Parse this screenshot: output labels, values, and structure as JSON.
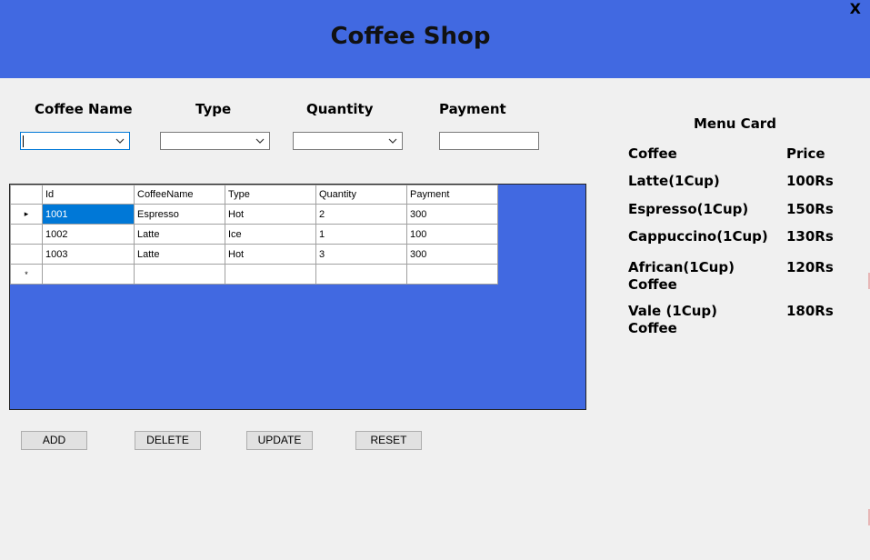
{
  "app": {
    "title": "Coffee Shop",
    "close_label": "X"
  },
  "form": {
    "coffee_name_label": "Coffee Name",
    "type_label": "Type",
    "quantity_label": "Quantity",
    "payment_label": "Payment",
    "coffee_name_value": "",
    "type_value": "",
    "quantity_value": "",
    "payment_value": ""
  },
  "grid": {
    "columns": [
      "Id",
      "CoffeeName",
      "Type",
      "Quantity",
      "Payment"
    ],
    "rows": [
      [
        "1001",
        "Espresso",
        "Hot",
        "2",
        "300"
      ],
      [
        "1002",
        "Latte",
        "Ice",
        "1",
        "100"
      ],
      [
        "1003",
        "Latte",
        "Hot",
        "3",
        "300"
      ]
    ],
    "current_row_marker": "▸",
    "new_row_marker": "*"
  },
  "buttons": {
    "add": "ADD",
    "delete": "DELETE",
    "update": "UPDATE",
    "reset": "RESET"
  },
  "menu": {
    "title": "Menu Card",
    "coffee_header": "Coffee",
    "price_header": "Price",
    "items": [
      {
        "name": "Latte(1Cup)",
        "name_line2": "",
        "price": "100Rs"
      },
      {
        "name": "Espresso(1Cup)",
        "name_line2": "",
        "price": "150Rs"
      },
      {
        "name": "Cappuccino(1Cup)",
        "name_line2": "",
        "price": "130Rs"
      },
      {
        "name": "African(1Cup)",
        "name_line2": "Coffee",
        "price": "120Rs"
      },
      {
        "name": "Vale (1Cup)",
        "name_line2": "Coffee",
        "price": "180Rs"
      }
    ]
  },
  "colors": {
    "header": "#4169e1",
    "grid_panel": "#4169e1",
    "selection": "#0078d7",
    "background": "#f0f0f0"
  }
}
